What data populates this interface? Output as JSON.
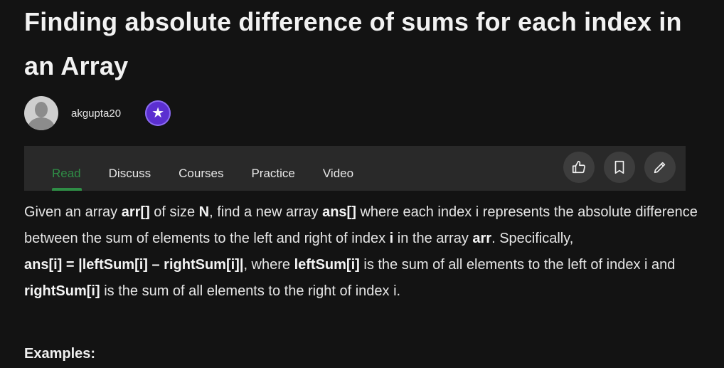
{
  "article": {
    "title": "Finding absolute difference of sums for each index in an Array",
    "author": "akgupta20",
    "badge_icon": "star-badge-icon",
    "accent_color": "#2f8d46",
    "badge_color": "#5b2fd0"
  },
  "tabs": [
    {
      "label": "Read",
      "active": true
    },
    {
      "label": "Discuss",
      "active": false
    },
    {
      "label": "Courses",
      "active": false
    },
    {
      "label": "Practice",
      "active": false
    },
    {
      "label": "Video",
      "active": false
    }
  ],
  "actions": [
    "like-icon",
    "bookmark-icon",
    "edit-icon"
  ],
  "body": {
    "p1": {
      "t1": "Given an array ",
      "b1": "arr[]",
      "t2": " of size ",
      "b2": "N",
      "t3": ", find a new array ",
      "b3": "ans[]",
      "t4": " where each index i represents the absolute difference between the sum of elements to the left and right of index ",
      "b4": "i",
      "t5": " in the array ",
      "b5": "arr",
      "t6": ". Specifically,"
    },
    "p2": {
      "b1": "ans[i] = |leftSum[i] – rightSum[i]|",
      "t1": ", where ",
      "b2": "leftSum[i]",
      "t2": " is the sum of all elements to the left of index i and ",
      "b3": "rightSum[i]",
      "t3": " is the sum of all elements to the right of index i."
    },
    "examples_heading": "Examples:"
  }
}
